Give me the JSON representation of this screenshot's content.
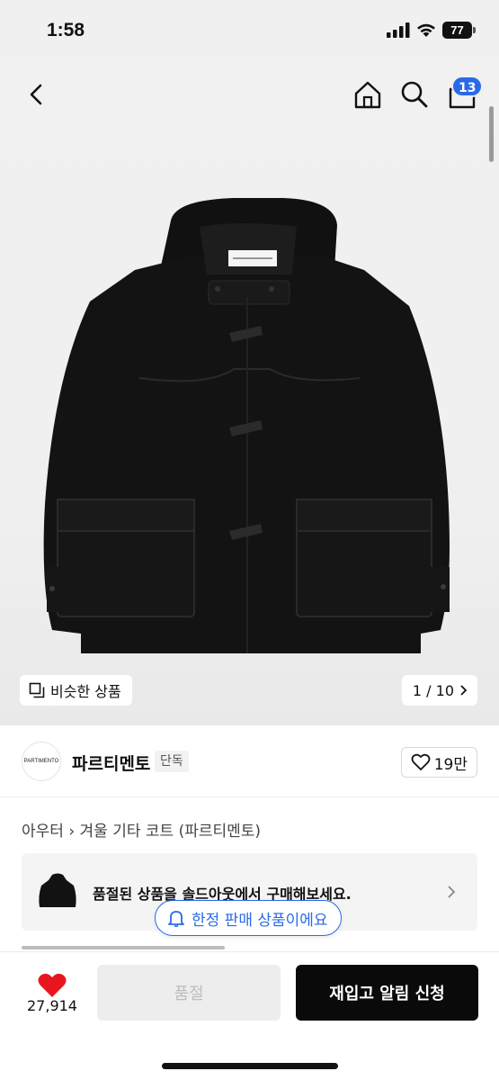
{
  "status_bar": {
    "time": "1:58",
    "battery": "77"
  },
  "nav": {
    "cart_count": "13"
  },
  "gallery": {
    "similar_label": "비슷한 상품",
    "page_indicator": "1 / 10"
  },
  "brand": {
    "logo_text": "PARTIMENTO",
    "name": "파르티멘토",
    "tag": "단독",
    "likes": "19만"
  },
  "category": {
    "parent": "아우터",
    "path": "겨울 기타 코트 (파르티멘토)"
  },
  "banner": {
    "text": "품절된 상품을 솔드아웃에서 구매해보세요."
  },
  "limited_pill": {
    "text": "한정 판매 상품이에요"
  },
  "bottom_bar": {
    "heart_count": "27,914",
    "soldout_label": "품절",
    "restock_label": "재입고 알림 신청"
  },
  "colors": {
    "accent": "#2a6ae9",
    "heart": "#e8171f",
    "cta": "#0a0a0a"
  },
  "icons": [
    "back-icon",
    "home-icon",
    "search-icon",
    "cart-icon",
    "similar-icon",
    "chevron-right-icon",
    "heart-outline-icon",
    "bell-icon",
    "heart-filled-icon"
  ]
}
